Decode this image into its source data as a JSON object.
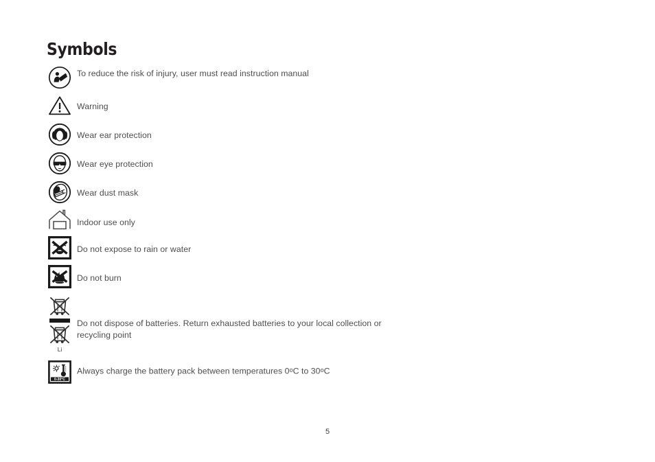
{
  "document": {
    "title": "Symbols",
    "page_number": "5",
    "text_color": "#4d4d4d",
    "heading_color": "#231f20",
    "background_color": "#ffffff"
  },
  "symbols": [
    {
      "icon": "read-instruction-manual-icon",
      "label": "To reduce the risk of injury, user must read instruction manual"
    },
    {
      "icon": "warning-triangle-icon",
      "label": "Warning"
    },
    {
      "icon": "wear-ear-protection-icon",
      "label": "Wear ear protection"
    },
    {
      "icon": "wear-eye-protection-icon",
      "label": "Wear eye protection"
    },
    {
      "icon": "wear-dust-mask-icon",
      "label": "Wear dust mask"
    },
    {
      "icon": "indoor-use-only-icon",
      "label": "Indoor use only"
    },
    {
      "icon": "no-rain-or-water-icon",
      "label": "Do not expose to rain or water"
    },
    {
      "icon": "do-not-burn-icon",
      "label": "Do not burn"
    },
    {
      "icon": "weee-crossed-out-bin-icon",
      "label": "Do not dispose of batteries. Return exhausted batteries to your local collection or recycling point",
      "sub_label": "Li"
    },
    {
      "icon": "charge-temperature-range-icon",
      "label_parts": {
        "before": "Always charge the battery pack between temperatures 0",
        "degree_1": "o",
        "middle": "C to 30",
        "degree_2": "o",
        "after": "C"
      },
      "label": "Always charge the battery pack between temperatures 0oC to 30oC",
      "icon_caption": "0 - 30°C"
    }
  ]
}
